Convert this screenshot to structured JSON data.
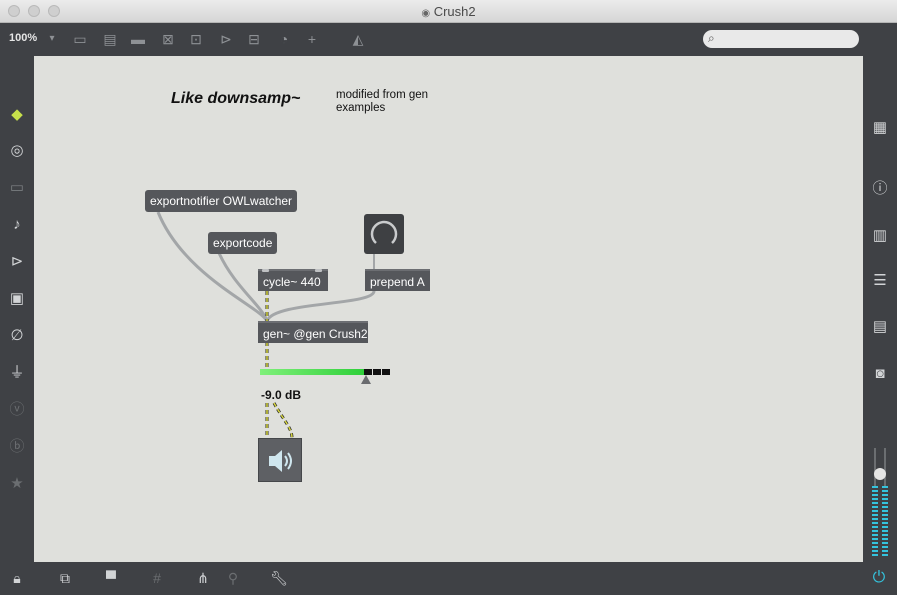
{
  "window": {
    "title": "Crush2"
  },
  "toolbar": {
    "zoom": "100%"
  },
  "left_sidebar": [
    "cube-icon",
    "target-icon",
    "keyboard-icon",
    "music-note-icon",
    "play-list-icon",
    "image-icon",
    "paperclip-icon",
    "plug-icon",
    "vimeo-icon",
    "help-icon",
    "star-icon"
  ],
  "right_sidebar": [
    "grid-icon",
    "info-icon",
    "book-open-icon",
    "list-icon",
    "reference-icon",
    "camera-icon"
  ],
  "patch": {
    "title_comment": "Like downsamp~",
    "note_comment_line1": "modified from gen",
    "note_comment_line2": "examples",
    "objects": {
      "exportnotifier": "exportnotifier OWLwatcher",
      "exportcode": "exportcode",
      "cycle": "cycle~ 440",
      "prepend": "prepend A",
      "gen": "gen~ @gen Crush2"
    },
    "gain_display": "-9.0 dB",
    "gain_level": 0.76
  },
  "colors": {
    "meter_start": "#7ff07a",
    "meter_end": "#2fd03a",
    "canvas": "#dfe0dc"
  }
}
